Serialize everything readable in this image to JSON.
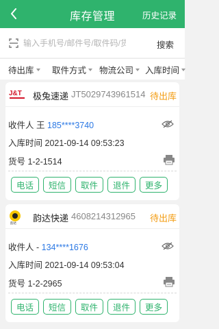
{
  "header": {
    "title": "库存管理",
    "history_label": "历史记录"
  },
  "search": {
    "placeholder": "输入手机号/邮件号/取件码/货",
    "button_label": "搜索"
  },
  "filters": [
    {
      "label": "待出库"
    },
    {
      "label": "取件方式"
    },
    {
      "label": "物流公司"
    },
    {
      "label": "入库时间"
    }
  ],
  "parcels": [
    {
      "logo_text": "J&T",
      "company": "极兔速递",
      "tracking": "JT5029743961514",
      "status": "待出库",
      "recipient_label": "收件人",
      "recipient_name": "王",
      "phone": "185****3740",
      "time_label": "入库时间",
      "time": "2021-09-14 09:53:23",
      "slot_label": "货号",
      "slot": "1-2-1514",
      "actions": [
        "电话",
        "短信",
        "取件",
        "退件",
        "更多"
      ]
    },
    {
      "logo_text": "韵达",
      "company": "韵达快递",
      "tracking": "4608214312965",
      "status": "待出库",
      "recipient_label": "收件人",
      "recipient_name": "-",
      "phone": "134****1676",
      "time_label": "入库时间",
      "time": "2021-09-14 09:53:04",
      "slot_label": "货号",
      "slot": "1-2-2965",
      "actions": [
        "电话",
        "短信",
        "取件",
        "退件",
        "更多"
      ]
    }
  ],
  "colors": {
    "brand": "#2fb36d",
    "status": "#f39c12",
    "phone": "#2b78e4"
  }
}
